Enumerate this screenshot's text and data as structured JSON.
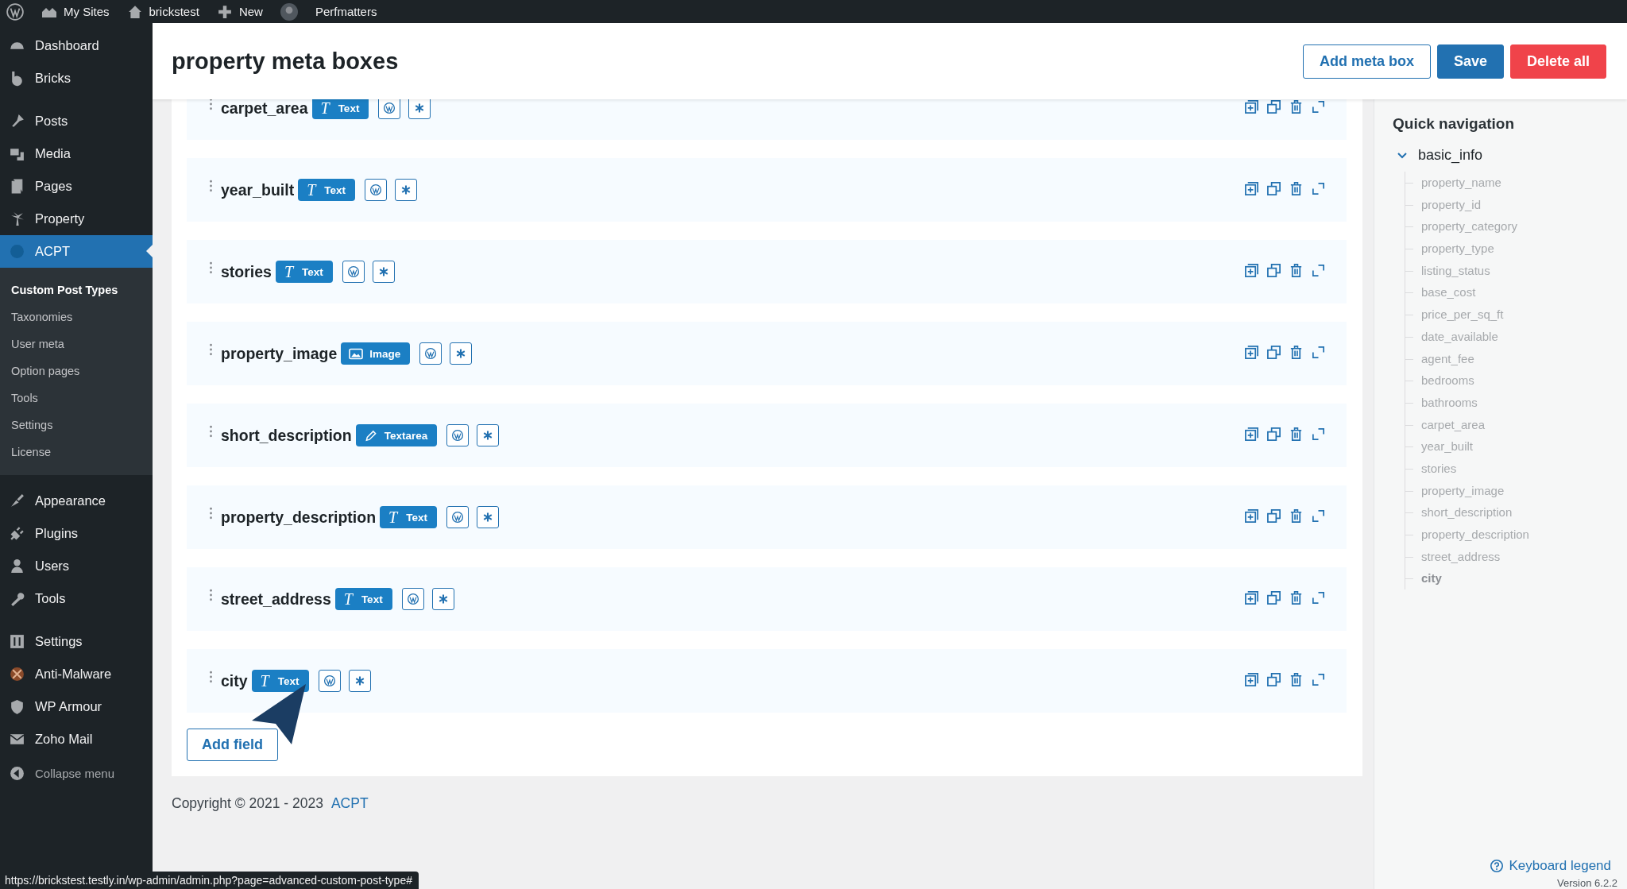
{
  "top_bar": {
    "items": [
      {
        "label": "My Sites"
      },
      {
        "label": "brickstest"
      },
      {
        "label": "New"
      },
      {
        "label": "Perfmatters"
      }
    ]
  },
  "sidebar": {
    "items": [
      {
        "label": "Dashboard",
        "selected": false
      },
      {
        "label": "Bricks",
        "selected": false
      },
      {
        "label": "Posts",
        "selected": false
      },
      {
        "label": "Media",
        "selected": false
      },
      {
        "label": "Pages",
        "selected": false
      },
      {
        "label": "Property",
        "selected": false
      },
      {
        "label": "ACPT",
        "selected": true,
        "children": [
          {
            "label": "Custom Post Types",
            "selected": true
          },
          {
            "label": "Taxonomies",
            "selected": false
          },
          {
            "label": "User meta",
            "selected": false
          },
          {
            "label": "Option pages",
            "selected": false
          },
          {
            "label": "Tools",
            "selected": false
          },
          {
            "label": "Settings",
            "selected": false
          },
          {
            "label": "License",
            "selected": false
          }
        ]
      },
      {
        "label": "Appearance",
        "selected": false
      },
      {
        "label": "Plugins",
        "selected": false
      },
      {
        "label": "Users",
        "selected": false
      },
      {
        "label": "Tools",
        "selected": false
      },
      {
        "label": "Settings",
        "selected": false
      },
      {
        "label": "Anti-Malware",
        "selected": false
      },
      {
        "label": "WP Armour",
        "selected": false
      },
      {
        "label": "Zoho Mail",
        "selected": false
      }
    ],
    "collapse": "Collapse menu"
  },
  "header": {
    "title": "property meta boxes",
    "buttons": [
      {
        "label": "Add meta box",
        "kind": "outline"
      },
      {
        "label": "Save",
        "kind": "primary"
      },
      {
        "label": "Delete all",
        "kind": "danger"
      }
    ]
  },
  "fields": [
    {
      "name": "carpet_area",
      "type": {
        "kind": "text",
        "icon": "T",
        "label": "Text"
      }
    },
    {
      "name": "year_built",
      "type": {
        "kind": "text",
        "icon": "T",
        "label": "Text"
      }
    },
    {
      "name": "stories",
      "type": {
        "kind": "text",
        "icon": "T",
        "label": "Text"
      }
    },
    {
      "name": "property_image",
      "type": {
        "kind": "image",
        "label": "Image"
      }
    },
    {
      "name": "short_description",
      "type": {
        "kind": "textarea",
        "label": "Textarea"
      }
    },
    {
      "name": "property_description",
      "type": {
        "kind": "text",
        "icon": "T",
        "label": "Text"
      }
    },
    {
      "name": "street_address",
      "type": {
        "kind": "text",
        "icon": "T",
        "label": "Text"
      }
    },
    {
      "name": "city",
      "type": {
        "kind": "text",
        "icon": "T",
        "label": "Text"
      }
    }
  ],
  "add_field": "Add field",
  "footer": {
    "copyright": "Copyright © 2021 - 2023",
    "link": "ACPT"
  },
  "quick_navigation": {
    "title": "Quick navigation",
    "group": {
      "label": "basic_info",
      "expanded": true,
      "children": [
        {
          "label": "property_name",
          "selected": false
        },
        {
          "label": "property_id",
          "selected": false
        },
        {
          "label": "property_category",
          "selected": false
        },
        {
          "label": "property_type",
          "selected": false
        },
        {
          "label": "listing_status",
          "selected": false
        },
        {
          "label": "base_cost",
          "selected": false
        },
        {
          "label": "price_per_sq_ft",
          "selected": false
        },
        {
          "label": "date_available",
          "selected": false
        },
        {
          "label": "agent_fee",
          "selected": false
        },
        {
          "label": "bedrooms",
          "selected": false
        },
        {
          "label": "bathrooms",
          "selected": false
        },
        {
          "label": "carpet_area",
          "selected": false
        },
        {
          "label": "year_built",
          "selected": false
        },
        {
          "label": "stories",
          "selected": false
        },
        {
          "label": "property_image",
          "selected": false
        },
        {
          "label": "short_description",
          "selected": false
        },
        {
          "label": "property_description",
          "selected": false
        },
        {
          "label": "street_address",
          "selected": false
        },
        {
          "label": "city",
          "selected": true
        }
      ]
    },
    "keyboard_legend": "Keyboard legend",
    "version": "Version 6.2.2"
  },
  "status_bar": {
    "url": "https://brickstest.testly.in/wp-admin/admin.php?page=advanced-custom-post-type#"
  }
}
